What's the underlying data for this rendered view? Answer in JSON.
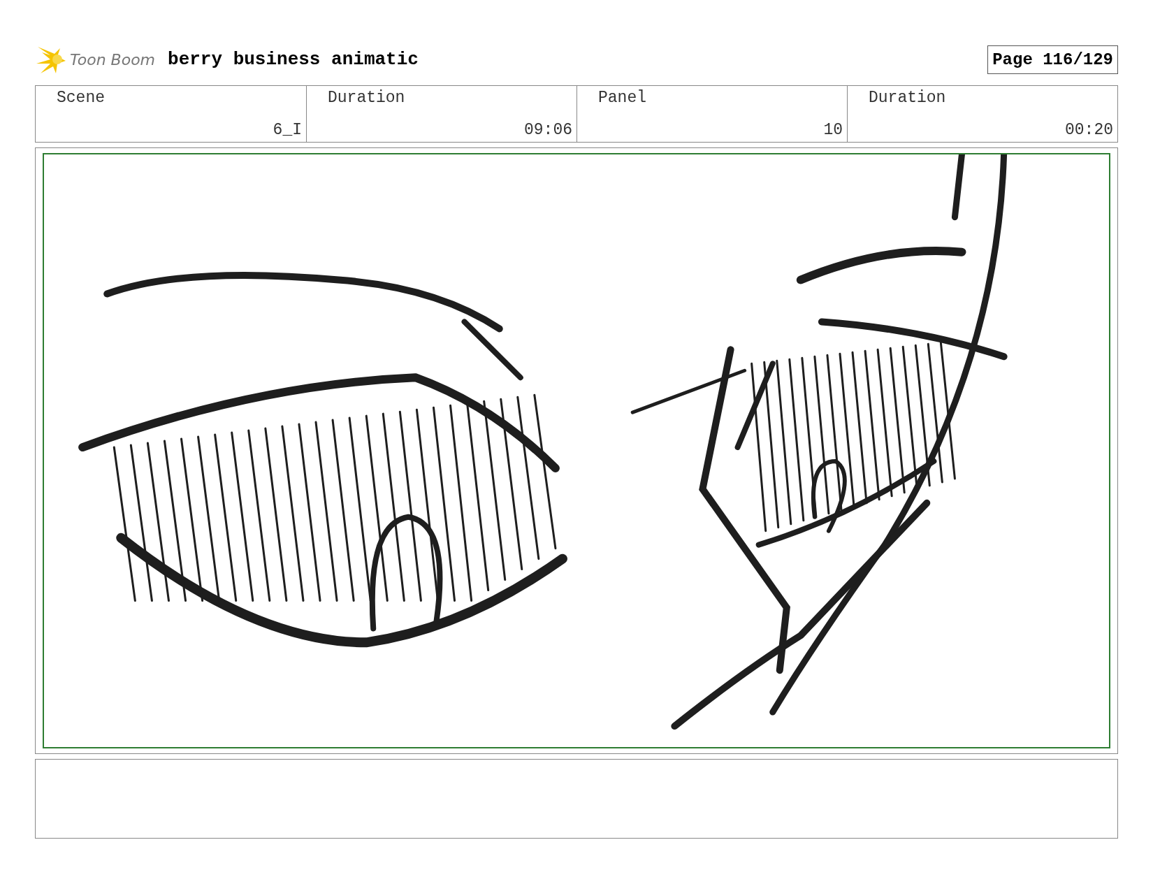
{
  "header": {
    "logo_text": "Toon Boom",
    "title": "berry business animatic",
    "page": "Page 116/129"
  },
  "info": [
    {
      "label": "Scene",
      "value": "6_I"
    },
    {
      "label": "Duration",
      "value": "09:06"
    },
    {
      "label": "Panel",
      "value": "10"
    },
    {
      "label": "Duration",
      "value": "00:20"
    }
  ]
}
